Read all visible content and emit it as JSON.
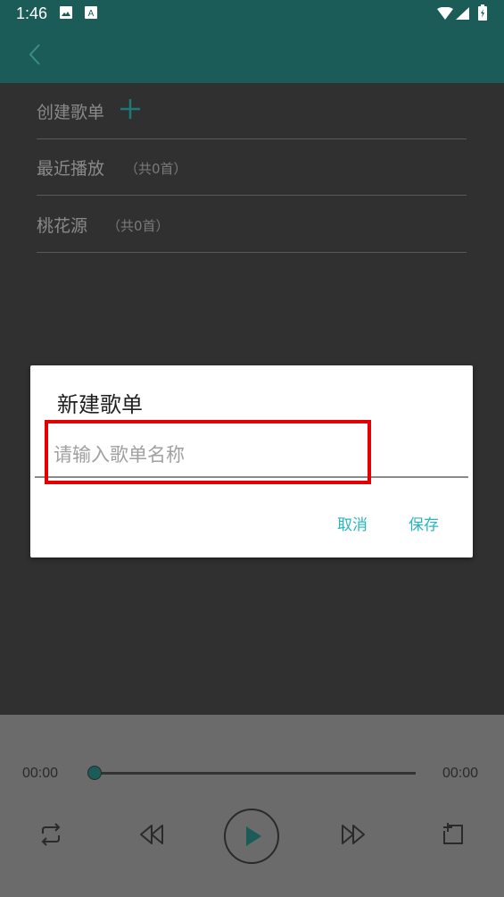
{
  "status_bar": {
    "time": "1:46",
    "icons": [
      "image-icon",
      "a-badge-icon",
      "wifi-icon",
      "signal-icon",
      "battery-icon"
    ]
  },
  "app_bar": {
    "back_icon": "chevron-left-icon"
  },
  "playlist": {
    "create_label": "创建歌单",
    "create_icon": "plus-icon",
    "items": [
      {
        "name": "最近播放",
        "count": "（共0首）"
      },
      {
        "name": "桃花源",
        "count": "（共0首）"
      }
    ]
  },
  "dialog": {
    "title": "新建歌单",
    "input_placeholder": "请输入歌单名称",
    "input_value": "",
    "cancel_label": "取消",
    "save_label": "保存"
  },
  "player": {
    "current_time": "00:00",
    "total_time": "00:00",
    "progress": 0,
    "controls": [
      "repeat-icon",
      "rewind-icon",
      "play-icon",
      "fast-forward-icon",
      "add-to-playlist-icon"
    ]
  },
  "colors": {
    "primary": "#1b5c58",
    "accent": "#26b7bd",
    "highlight": "#e30000"
  }
}
